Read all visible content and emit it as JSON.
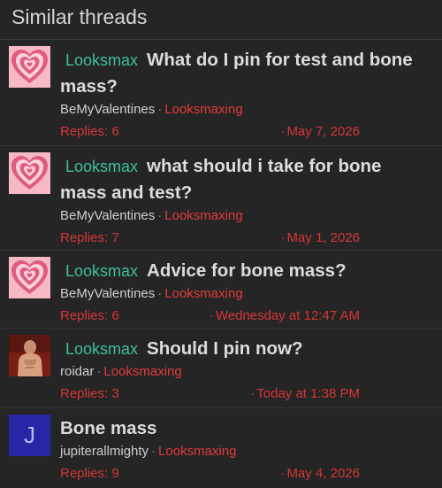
{
  "header": {
    "title": "Similar threads"
  },
  "threads": [
    {
      "avatar": "heart-avatar",
      "prefix": "Looksmax",
      "title": "What do I pin for test and bone mass?",
      "author": "BeMyValentines",
      "forum": "Looksmaxing",
      "replies": "Replies: 6",
      "date": "May 7, 2026"
    },
    {
      "avatar": "heart-avatar",
      "prefix": "Looksmax",
      "title": "what should i take for bone mass and test?",
      "author": "BeMyValentines",
      "forum": "Looksmaxing",
      "replies": "Replies: 7",
      "date": "May 1, 2026"
    },
    {
      "avatar": "heart-avatar",
      "prefix": "Looksmax",
      "title": "Advice for bone mass?",
      "author": "BeMyValentines",
      "forum": "Looksmaxing",
      "replies": "Replies: 6",
      "date": "Wednesday at 12:47 AM"
    },
    {
      "avatar": "photo-avatar",
      "prefix": "Looksmax",
      "title": "Should I pin now?",
      "author": "roidar",
      "forum": "Looksmaxing",
      "replies": "Replies: 3",
      "date": "Today at 1:38 PM"
    },
    {
      "avatar": "letter-avatar",
      "avatar_letter": "J",
      "prefix": "",
      "title": "Bone mass",
      "author": "jupiterallmighty",
      "forum": "Looksmaxing",
      "replies": "Replies: 9",
      "date": "May 4, 2026"
    }
  ],
  "colors": {
    "background": "#252525",
    "prefix": "#3fbf9e",
    "forum_link": "#e03a3a",
    "stats": "#d63636",
    "letter_avatar_bg": "#2826a6"
  }
}
